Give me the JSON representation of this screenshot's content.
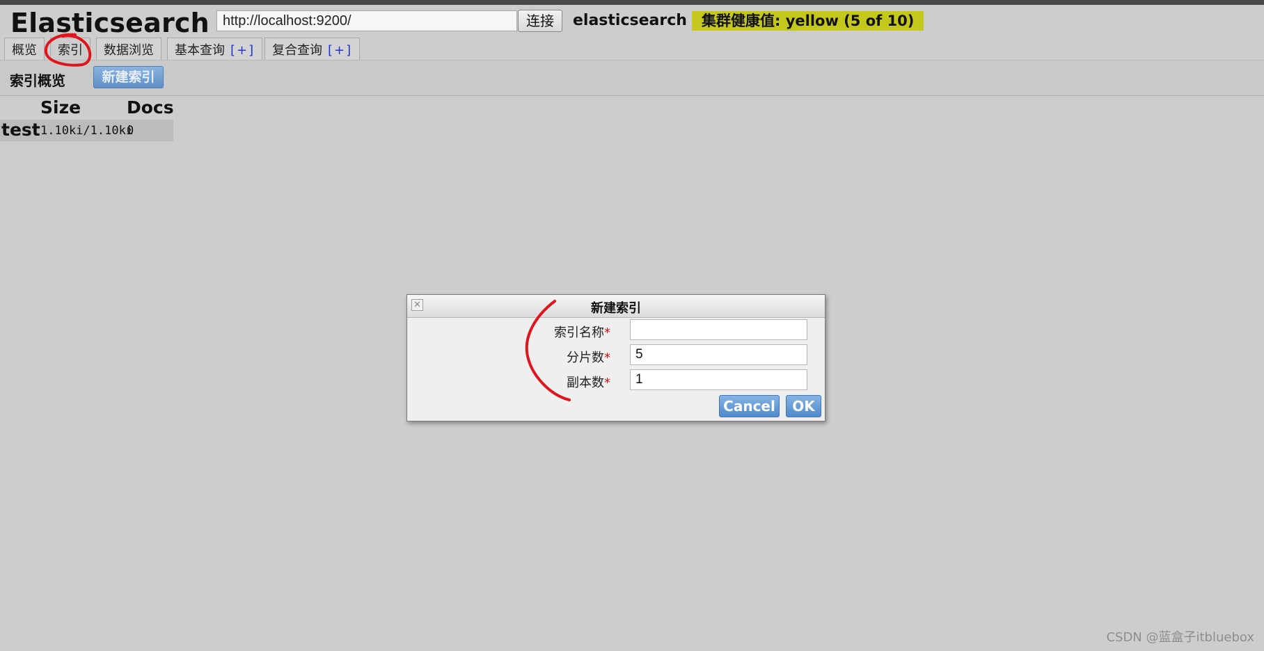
{
  "header": {
    "brand": "Elasticsearch",
    "url_value": "http://localhost:9200/",
    "connect_label": "连接",
    "cluster_name": "elasticsearch",
    "health_text": "集群健康值: yellow (5 of 10)",
    "health_color": "#c4c71c"
  },
  "tabs": [
    {
      "label": "概览",
      "plus": ""
    },
    {
      "label": "索引",
      "plus": "",
      "active": true
    },
    {
      "label": "数据浏览",
      "plus": ""
    },
    {
      "label": "基本查询",
      "plus": "[+]"
    },
    {
      "label": "复合查询",
      "plus": "[+]"
    }
  ],
  "subbar": {
    "title": "索引概览",
    "new_index_label": "新建索引"
  },
  "index_table": {
    "columns": [
      "Size",
      "Docs"
    ],
    "rows": [
      {
        "name": "test",
        "size": "1.10ki/1.10ki",
        "docs": "0"
      }
    ]
  },
  "dialog": {
    "title": "新建索引",
    "close_icon": "close-icon",
    "fields": [
      {
        "label": "索引名称",
        "required": "*",
        "value": ""
      },
      {
        "label": "分片数",
        "required": "*",
        "value": "5"
      },
      {
        "label": "副本数",
        "required": "*",
        "value": "1"
      }
    ],
    "cancel_label": "Cancel",
    "ok_label": "OK"
  },
  "watermark": "CSDN @蓝盒子itbluebox",
  "colors": {
    "annotation": "#e0141b",
    "primary_button": "#5d8fc8",
    "background": "#cdcdcd"
  }
}
